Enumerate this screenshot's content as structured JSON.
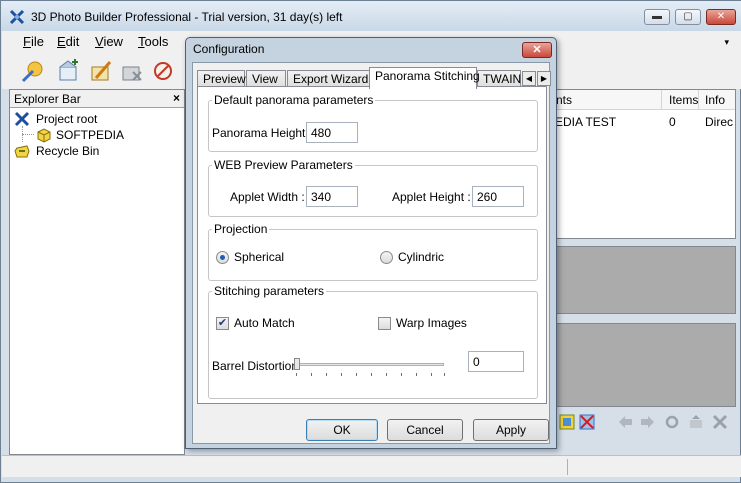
{
  "app": {
    "title": "3D Photo Builder Professional - Trial version, 31 day(s) left"
  },
  "window_controls": {
    "minimize": "▬",
    "maximize": "▢",
    "close": "✕"
  },
  "menu": [
    {
      "label": "File",
      "hotkey": "F",
      "rest": "ile"
    },
    {
      "label": "Edit",
      "hotkey": "E",
      "rest": "dit"
    },
    {
      "label": "View",
      "hotkey": "V",
      "rest": "iew"
    },
    {
      "label": "Tools",
      "hotkey": "T",
      "rest": "ools"
    }
  ],
  "menu_overflow": "▾",
  "toolbar_icons": [
    "wizard-icon",
    "new-project-icon",
    "edit-project-icon",
    "delete-project-icon",
    "settings-icon"
  ],
  "explorer": {
    "title": "Explorer Bar",
    "close": "×",
    "tree": [
      {
        "label": "Project root",
        "icon": "project-root-icon"
      },
      {
        "label": "SOFTPEDIA",
        "icon": "folder-3d-icon"
      },
      {
        "label": "Recycle Bin",
        "icon": "recycle-bin-icon"
      }
    ]
  },
  "list": {
    "columns": [
      "nts",
      "Items",
      "Info"
    ],
    "row": [
      "EDIA TEST",
      "0",
      "Direc"
    ]
  },
  "dialog": {
    "title": "Configuration",
    "close": "✕",
    "tabs": [
      "Preview",
      "View",
      "Export Wizard",
      "Panorama Stitching",
      "TWAIN"
    ],
    "active_tab": "Panorama Stitching",
    "tab_scroll_left": "◀",
    "tab_scroll_right": "▶",
    "default_params": {
      "group": "Default panorama parameters",
      "height_label": "Panorama Height :",
      "height_value": "480"
    },
    "web_preview": {
      "group": "WEB Preview Parameters",
      "width_label": "Applet Width :",
      "width_value": "340",
      "height_label": "Applet Height :",
      "height_value": "260"
    },
    "projection": {
      "group": "Projection",
      "spherical": "Spherical",
      "cylindric": "Cylindric",
      "selected": "Spherical"
    },
    "stitching": {
      "group": "Stitching parameters",
      "auto_match": "Auto Match",
      "auto_match_checked": true,
      "warp_images": "Warp Images",
      "warp_images_checked": false,
      "barrel_label": "Barrel Distortion",
      "barrel_value": "0",
      "check_mark": "✔"
    },
    "buttons": {
      "ok": "OK",
      "cancel": "Cancel",
      "apply": "Apply"
    }
  }
}
